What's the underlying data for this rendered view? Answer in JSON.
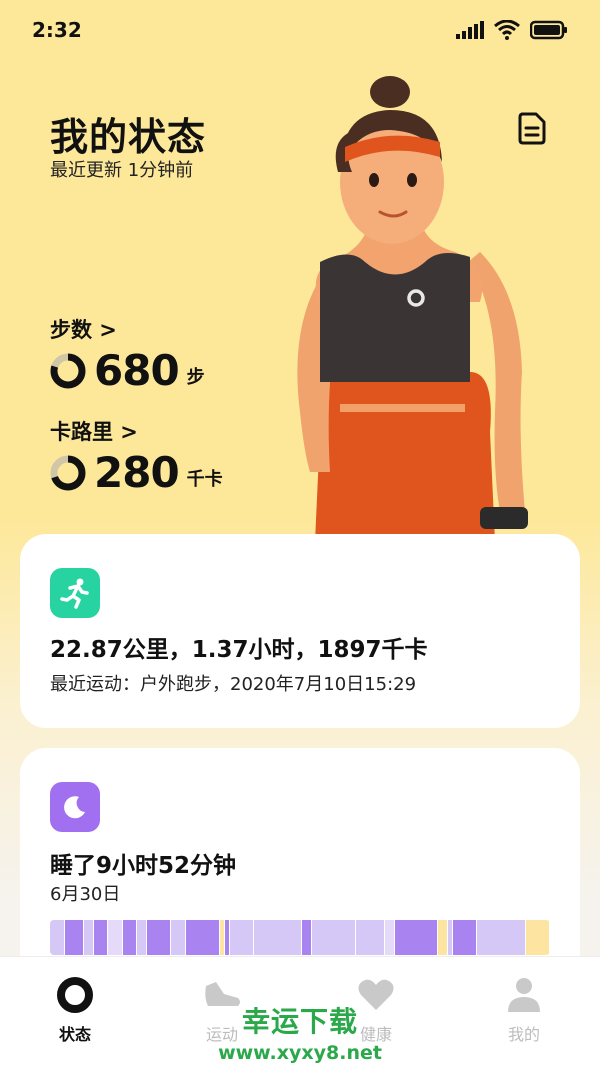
{
  "status_bar": {
    "time": "2:32"
  },
  "header": {
    "title": "我的状态",
    "subtitle": "最近更新 1分钟前"
  },
  "steps": {
    "label": "步数 >",
    "value": "680",
    "unit": "步",
    "progress": 0.8
  },
  "calories": {
    "label": "卡路里 >",
    "value": "280",
    "unit": "千卡",
    "progress": 0.7
  },
  "workout_card": {
    "summary": "22.87公里，1.37小时，1897千卡",
    "detail": "最近运动：户外跑步，2020年7月10日15:29",
    "icon_color": "#27d3a1"
  },
  "sleep_card": {
    "summary": "睡了9小时52分钟",
    "date": "6月30日",
    "icon_color": "#a070f0",
    "segments": [
      {
        "c": "#d6c8f6",
        "w": 3
      },
      {
        "c": "#a983f0",
        "w": 4
      },
      {
        "c": "#d6c8f6",
        "w": 2
      },
      {
        "c": "#a983f0",
        "w": 3
      },
      {
        "c": "#e5dbf9",
        "w": 3
      },
      {
        "c": "#a983f0",
        "w": 3
      },
      {
        "c": "#d6c8f6",
        "w": 2
      },
      {
        "c": "#a983f0",
        "w": 5
      },
      {
        "c": "#d6c8f6",
        "w": 3
      },
      {
        "c": "#a983f0",
        "w": 7
      },
      {
        "c": "#fde4a0",
        "w": 1
      },
      {
        "c": "#a983f0",
        "w": 1
      },
      {
        "c": "#d6c8f6",
        "w": 5
      },
      {
        "c": "#d6c8f6",
        "w": 10
      },
      {
        "c": "#a983f0",
        "w": 2
      },
      {
        "c": "#d6c8f6",
        "w": 9
      },
      {
        "c": "#d6c8f6",
        "w": 6
      },
      {
        "c": "#e5dbf9",
        "w": 2
      },
      {
        "c": "#a983f0",
        "w": 9
      },
      {
        "c": "#fde4a0",
        "w": 2
      },
      {
        "c": "#d6c8f6",
        "w": 1
      },
      {
        "c": "#a983f0",
        "w": 5
      },
      {
        "c": "#d6c8f6",
        "w": 10
      },
      {
        "c": "#fde4a0",
        "w": 5
      }
    ]
  },
  "tabs": [
    {
      "label": "状态",
      "icon": "status-ring-icon",
      "active": true
    },
    {
      "label": "运动",
      "icon": "shoe-icon",
      "active": false
    },
    {
      "label": "健康",
      "icon": "heart-icon",
      "active": false
    },
    {
      "label": "我的",
      "icon": "person-icon",
      "active": false
    }
  ],
  "watermark": {
    "main": "幸运下载",
    "url": "www.xyxy8.net"
  }
}
